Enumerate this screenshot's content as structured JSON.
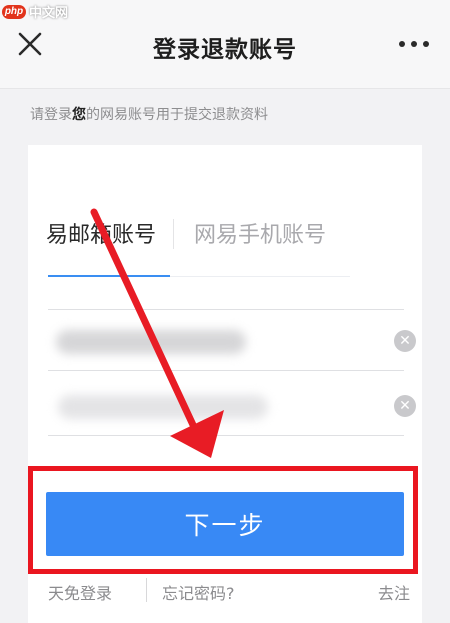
{
  "watermark": {
    "logo_text": "php",
    "site_text": "中文网"
  },
  "header": {
    "title": "登录退款账号",
    "close_icon": "close-icon",
    "more_icon": "more-dots-icon"
  },
  "subtitle": {
    "prefix": "请登录",
    "highlight": "您",
    "suffix": "的网易账号用于提交退款资料"
  },
  "tabs": [
    {
      "label": "易邮箱账号",
      "active": true
    },
    {
      "label": "网易手机账号",
      "active": false
    }
  ],
  "form": {
    "account_value": "",
    "password_value": "",
    "clear_icon": "clear-icon"
  },
  "next_button": {
    "label": "下一步"
  },
  "bottom_links": {
    "free_login": "天免登录",
    "forgot_password": "忘记密码?",
    "go": "去注"
  },
  "colors": {
    "accent": "#3889f5",
    "annotation_red": "#ea1620",
    "tab_underline": "#3a8ef2"
  }
}
